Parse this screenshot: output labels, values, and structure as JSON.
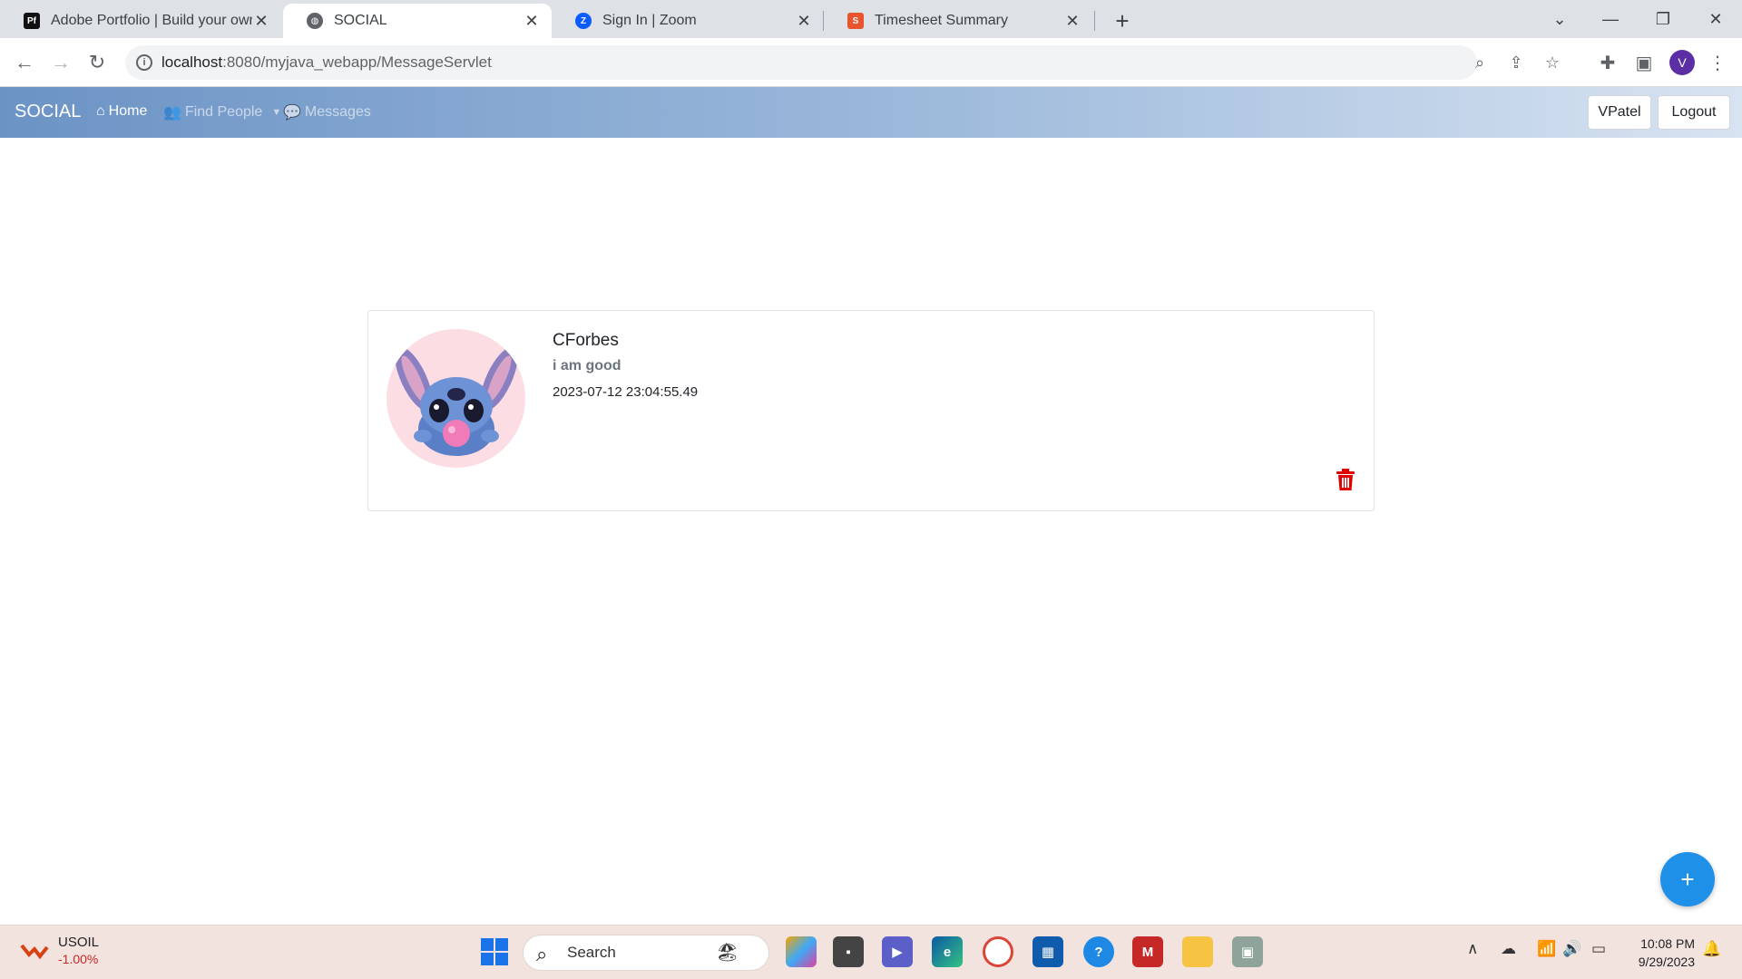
{
  "browser": {
    "tabs": [
      {
        "title": "Adobe Portfolio | Build your own",
        "favicon": "Pf",
        "active": false
      },
      {
        "title": "SOCIAL",
        "favicon": "globe-icon",
        "active": true
      },
      {
        "title": "Sign In | Zoom",
        "favicon": "Z",
        "active": false
      },
      {
        "title": "Timesheet Summary",
        "favicon": "S",
        "active": false
      }
    ],
    "url_host": "localhost",
    "url_path": ":8080/myjava_webapp/MessageServlet",
    "profile_initial": "V"
  },
  "app": {
    "brand": "SOCIAL",
    "nav": {
      "home": "Home",
      "find_people": "Find People",
      "messages": "Messages"
    },
    "user_button": "VPatel",
    "logout_button": "Logout"
  },
  "message": {
    "username": "CForbes",
    "text": "i am good",
    "timestamp": "2023-07-12 23:04:55.49"
  },
  "fab_label": "+",
  "taskbar": {
    "ticker_symbol": "USOIL",
    "ticker_change": "-1.00%",
    "search_placeholder": "Search",
    "time": "10:08 PM",
    "date": "9/29/2023"
  },
  "colors": {
    "navbar_start": "#6b93c5",
    "navbar_end": "#d8e3f1",
    "trash": "#e00000",
    "fab": "#1e90e8"
  }
}
